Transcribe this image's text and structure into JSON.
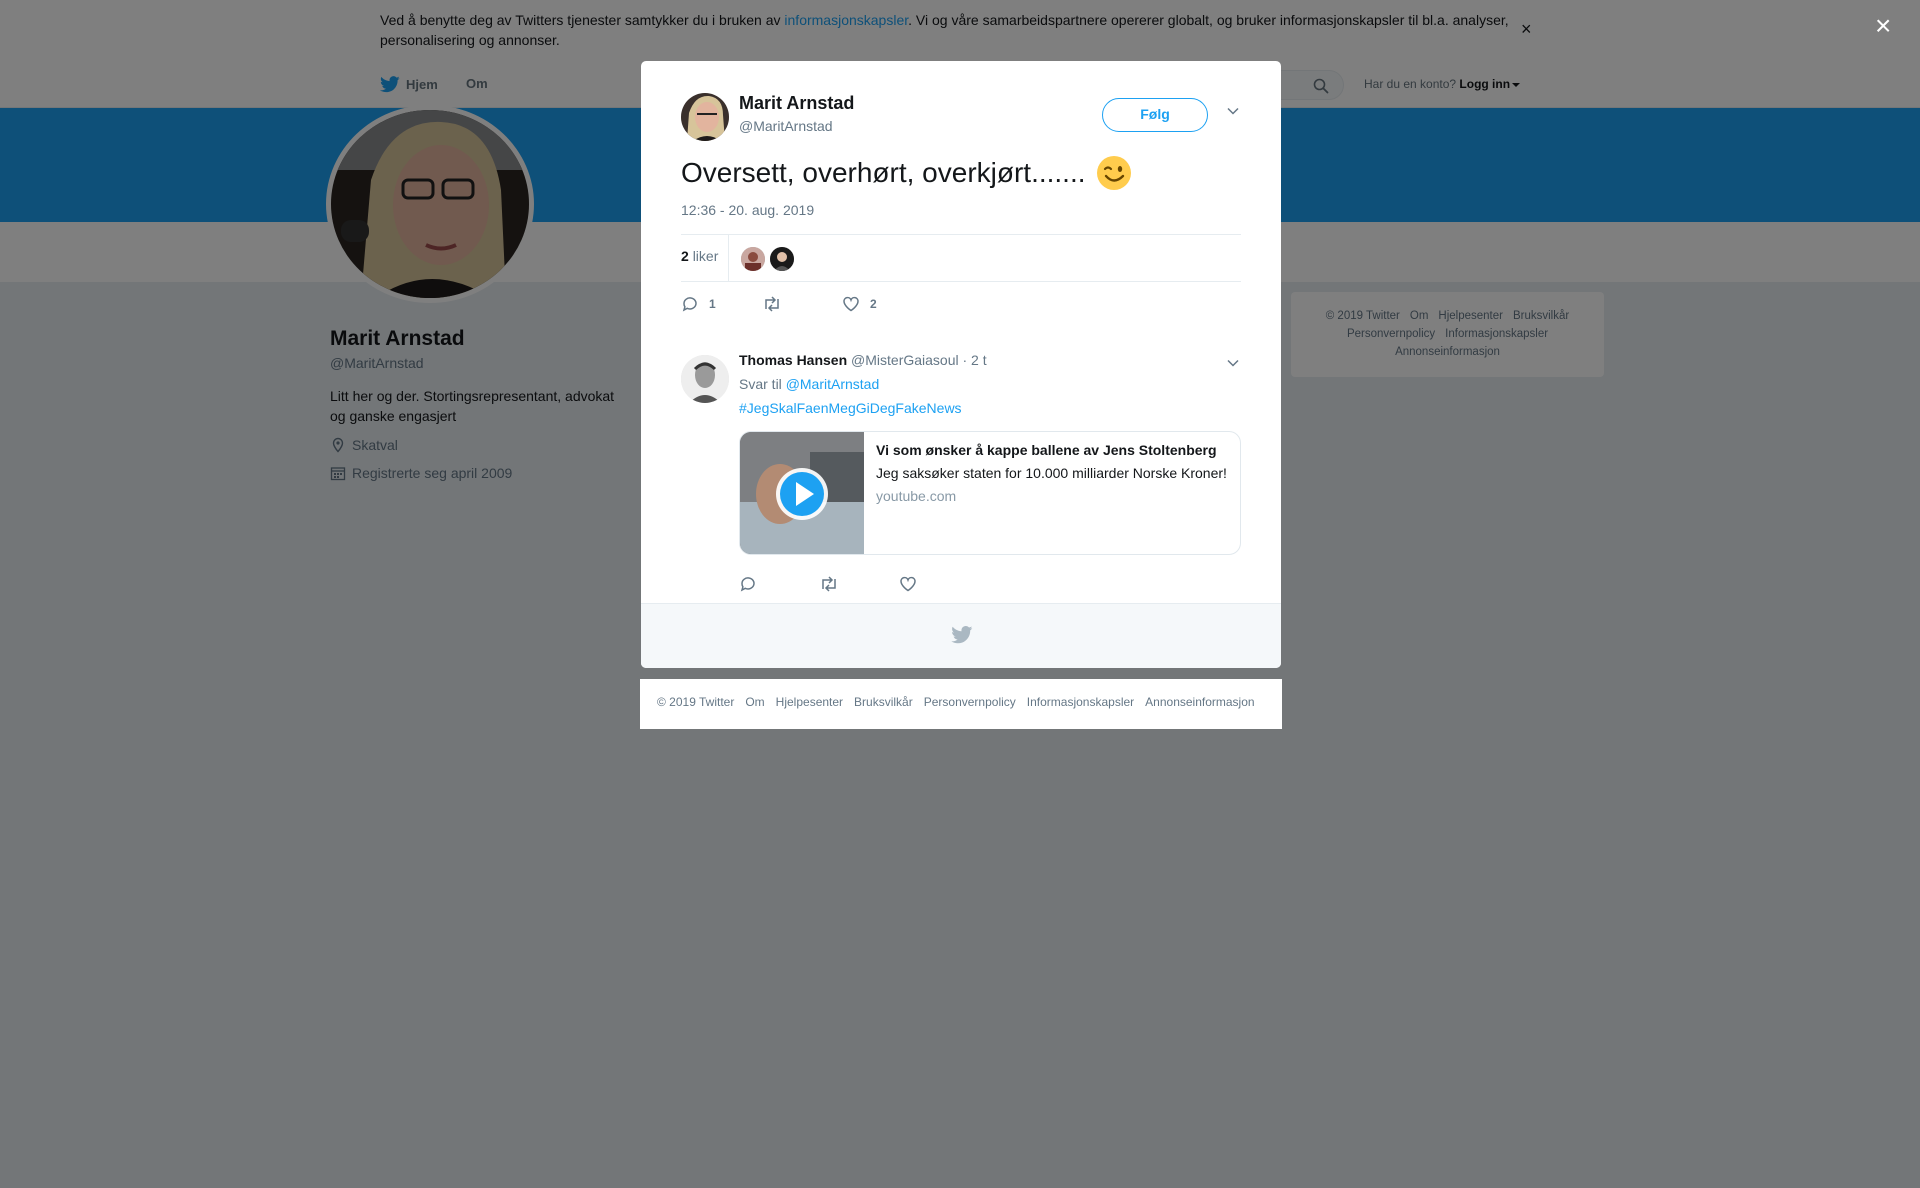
{
  "cookie": {
    "text_before": "Ved å benytte deg av Twitters tjenester samtykker du i bruken av ",
    "link": "informasjonskapsler",
    "text_after": ". Vi og våre samarbeidspartnere opererer globalt, og bruker informasjonskapsler til bl.a. analyser, personalisering og annonser.",
    "close": "×"
  },
  "nav": {
    "home": "Hjem",
    "about": "Om",
    "login_prompt": "Har du en konto?",
    "login": "Logg inn"
  },
  "profile": {
    "name": "Marit Arnstad",
    "handle": "@MaritArnstad",
    "bio": "Litt her og der. Stortingsrepresentant, advokat og ganske engasjert",
    "location": "Skatval",
    "joined": "Registrerte seg april 2009"
  },
  "side_footer": [
    "© 2019 Twitter",
    "Om",
    "Hjelpesenter",
    "Bruksvilkår",
    "Personvernpolicy",
    "Informasjonskapsler",
    "Annonseinformasjon"
  ],
  "overlay_close": "×",
  "tweet": {
    "author_name": "Marit Arnstad",
    "author_handle": "@MaritArnstad",
    "follow_label": "Følg",
    "text": "Oversett, overhørt, overkjørt.......",
    "emoji": "😉",
    "timestamp": "12:36 - 20. aug. 2019",
    "likes_number": "2",
    "likes_label": "liker",
    "reply_count": "1",
    "like_count": "2"
  },
  "reply": {
    "name": "Thomas Hansen",
    "handle": "@MisterGaiasoul",
    "time": "· 2 t",
    "reply_to_prefix": "Svar til",
    "reply_to": "@MaritArnstad",
    "hashtag": "#JegSkalFaenMegGiDegFakeNews",
    "card": {
      "title": "Vi som ønsker å kappe ballene av Jens Stoltenberg",
      "description": "Jeg saksøker staten for 10.000 milliarder Norske Kroner!",
      "domain": "youtube.com"
    }
  },
  "modal_footer": [
    "© 2019 Twitter",
    "Om",
    "Hjelpesenter",
    "Bruksvilkår",
    "Personvernpolicy",
    "Informasjonskapsler",
    "Annonseinformasjon"
  ],
  "icons": {
    "bird": "twitter-bird-icon",
    "search": "search-icon",
    "location": "location-pin-icon",
    "calendar": "calendar-icon",
    "reply": "reply-icon",
    "retweet": "retweet-icon",
    "like": "heart-icon",
    "chevron": "chevron-down-icon",
    "play": "play-icon"
  },
  "colors": {
    "brand": "#1da1f2",
    "text": "#14171a",
    "muted": "#657786",
    "overlay": "rgba(0,0,0,0.5)"
  }
}
